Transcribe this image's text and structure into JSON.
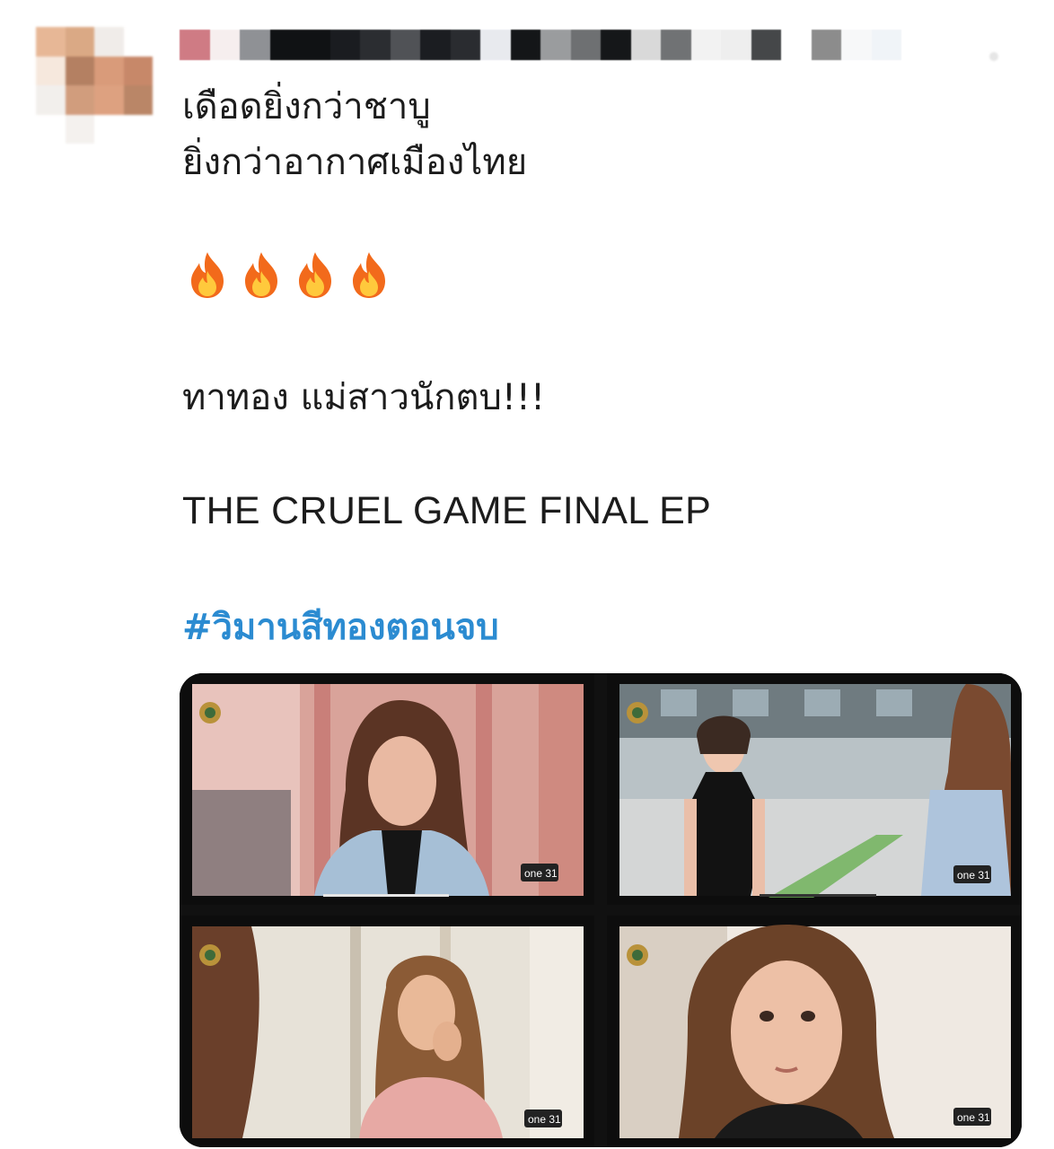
{
  "post": {
    "line1": "เดือดยิ่งกว่าชาบู",
    "line2": "ยิ่งกว่าอากาศเมืองไทย",
    "emoji": [
      "fire-emoji",
      "fire-emoji",
      "fire-emoji",
      "fire-emoji"
    ],
    "line3": "ทาทอง แม่สาวนักตบ!!!",
    "line4": "THE CRUEL GAME FINAL EP",
    "hashtag": "#วิมานสีทองตอนจบ"
  },
  "media": {
    "images": [
      {
        "logo": "one 31"
      },
      {
        "logo": "one 31"
      },
      {
        "logo": "one 31"
      },
      {
        "logo": "one 31"
      }
    ]
  },
  "colors": {
    "hashtag": "#2b8bd1",
    "text": "#1c1c1c",
    "fire_outer": "#f26a1b",
    "fire_inner": "#ffc93c"
  }
}
